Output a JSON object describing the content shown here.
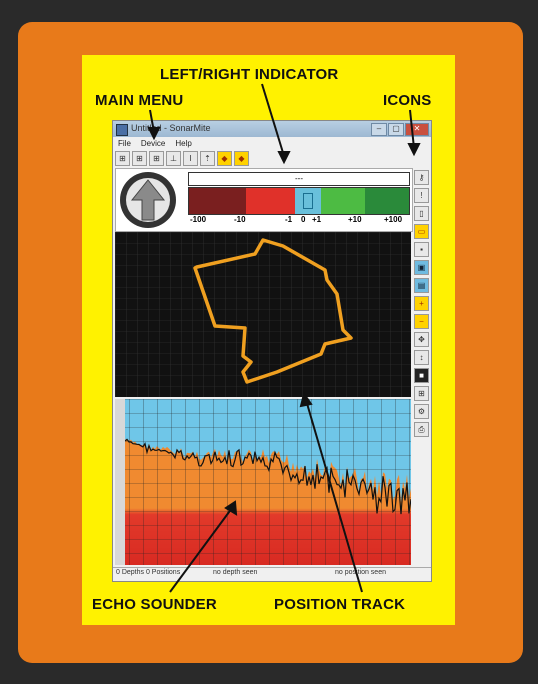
{
  "labels": {
    "left_right_indicator": "LEFT/RIGHT INDICATOR",
    "main_menu": "MAIN MENU",
    "icons": "ICONS",
    "echo_sounder": "ECHO SOUNDER",
    "position_track": "POSITION TRACK"
  },
  "window": {
    "title": "Untitled - SonarMite",
    "buttons": [
      "–",
      "▢",
      "✕"
    ]
  },
  "menu": [
    "File",
    "Device",
    "Help"
  ],
  "toolbar_icons": [
    "ruler-icon",
    "ruler-icon",
    "ruler-icon",
    "tee-icon",
    "i-beam-icon",
    "arrow-icon",
    "compass-icon",
    "compass-icon"
  ],
  "indicator": {
    "readout": "---",
    "scale": [
      "-100",
      "-10",
      "-1",
      "0",
      "+1",
      "+10",
      "+100"
    ],
    "colors": [
      "#7a1f1f",
      "#e0312a",
      "#69c0db",
      "#4dbb43",
      "#2a8a3a"
    ]
  },
  "sidebar_icons": [
    "key-icon",
    "exclamation-icon",
    "document-icon",
    "open-folder-icon",
    "save-icon",
    "screen-icon",
    "chart-icon",
    "zoom-in-icon",
    "zoom-out-icon",
    "pan-icon",
    "arrow-icon",
    "black-square-icon",
    "grid-icon",
    "settings-icon",
    "printer-icon"
  ],
  "status": {
    "positions": "0 Depths 0 Positions",
    "depth": "no depth seen",
    "position": "no position seen"
  },
  "colors": {
    "orange": "#e87a1a",
    "yellow": "#fff200",
    "track": "#f0a020",
    "water": "#6fc6e8",
    "bottom_upper": "#f08a30",
    "bottom_lower": "#e23a2a"
  }
}
